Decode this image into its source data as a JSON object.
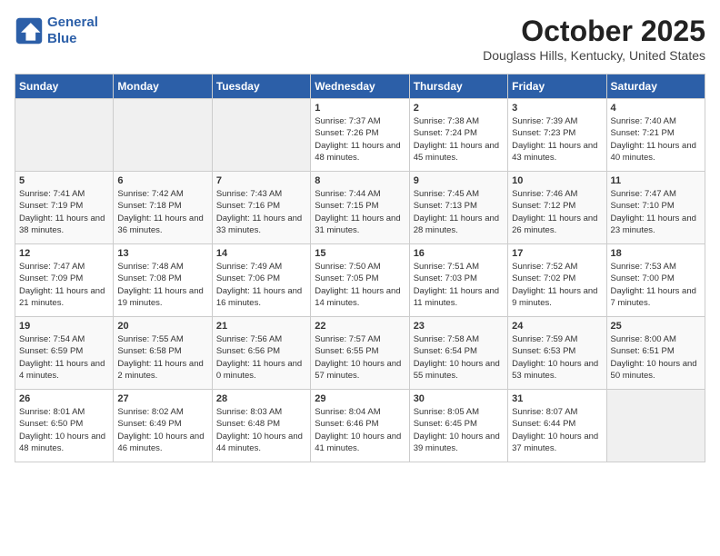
{
  "logo": {
    "line1": "General",
    "line2": "Blue"
  },
  "title": "October 2025",
  "location": "Douglass Hills, Kentucky, United States",
  "days_of_week": [
    "Sunday",
    "Monday",
    "Tuesday",
    "Wednesday",
    "Thursday",
    "Friday",
    "Saturday"
  ],
  "weeks": [
    [
      {
        "day": "",
        "empty": true
      },
      {
        "day": "",
        "empty": true
      },
      {
        "day": "",
        "empty": true
      },
      {
        "day": "1",
        "sunrise": "7:37 AM",
        "sunset": "7:26 PM",
        "daylight": "Daylight: 11 hours and 48 minutes."
      },
      {
        "day": "2",
        "sunrise": "7:38 AM",
        "sunset": "7:24 PM",
        "daylight": "Daylight: 11 hours and 45 minutes."
      },
      {
        "day": "3",
        "sunrise": "7:39 AM",
        "sunset": "7:23 PM",
        "daylight": "Daylight: 11 hours and 43 minutes."
      },
      {
        "day": "4",
        "sunrise": "7:40 AM",
        "sunset": "7:21 PM",
        "daylight": "Daylight: 11 hours and 40 minutes."
      }
    ],
    [
      {
        "day": "5",
        "sunrise": "7:41 AM",
        "sunset": "7:19 PM",
        "daylight": "Daylight: 11 hours and 38 minutes."
      },
      {
        "day": "6",
        "sunrise": "7:42 AM",
        "sunset": "7:18 PM",
        "daylight": "Daylight: 11 hours and 36 minutes."
      },
      {
        "day": "7",
        "sunrise": "7:43 AM",
        "sunset": "7:16 PM",
        "daylight": "Daylight: 11 hours and 33 minutes."
      },
      {
        "day": "8",
        "sunrise": "7:44 AM",
        "sunset": "7:15 PM",
        "daylight": "Daylight: 11 hours and 31 minutes."
      },
      {
        "day": "9",
        "sunrise": "7:45 AM",
        "sunset": "7:13 PM",
        "daylight": "Daylight: 11 hours and 28 minutes."
      },
      {
        "day": "10",
        "sunrise": "7:46 AM",
        "sunset": "7:12 PM",
        "daylight": "Daylight: 11 hours and 26 minutes."
      },
      {
        "day": "11",
        "sunrise": "7:47 AM",
        "sunset": "7:10 PM",
        "daylight": "Daylight: 11 hours and 23 minutes."
      }
    ],
    [
      {
        "day": "12",
        "sunrise": "7:47 AM",
        "sunset": "7:09 PM",
        "daylight": "Daylight: 11 hours and 21 minutes."
      },
      {
        "day": "13",
        "sunrise": "7:48 AM",
        "sunset": "7:08 PM",
        "daylight": "Daylight: 11 hours and 19 minutes."
      },
      {
        "day": "14",
        "sunrise": "7:49 AM",
        "sunset": "7:06 PM",
        "daylight": "Daylight: 11 hours and 16 minutes."
      },
      {
        "day": "15",
        "sunrise": "7:50 AM",
        "sunset": "7:05 PM",
        "daylight": "Daylight: 11 hours and 14 minutes."
      },
      {
        "day": "16",
        "sunrise": "7:51 AM",
        "sunset": "7:03 PM",
        "daylight": "Daylight: 11 hours and 11 minutes."
      },
      {
        "day": "17",
        "sunrise": "7:52 AM",
        "sunset": "7:02 PM",
        "daylight": "Daylight: 11 hours and 9 minutes."
      },
      {
        "day": "18",
        "sunrise": "7:53 AM",
        "sunset": "7:00 PM",
        "daylight": "Daylight: 11 hours and 7 minutes."
      }
    ],
    [
      {
        "day": "19",
        "sunrise": "7:54 AM",
        "sunset": "6:59 PM",
        "daylight": "Daylight: 11 hours and 4 minutes."
      },
      {
        "day": "20",
        "sunrise": "7:55 AM",
        "sunset": "6:58 PM",
        "daylight": "Daylight: 11 hours and 2 minutes."
      },
      {
        "day": "21",
        "sunrise": "7:56 AM",
        "sunset": "6:56 PM",
        "daylight": "Daylight: 11 hours and 0 minutes."
      },
      {
        "day": "22",
        "sunrise": "7:57 AM",
        "sunset": "6:55 PM",
        "daylight": "Daylight: 10 hours and 57 minutes."
      },
      {
        "day": "23",
        "sunrise": "7:58 AM",
        "sunset": "6:54 PM",
        "daylight": "Daylight: 10 hours and 55 minutes."
      },
      {
        "day": "24",
        "sunrise": "7:59 AM",
        "sunset": "6:53 PM",
        "daylight": "Daylight: 10 hours and 53 minutes."
      },
      {
        "day": "25",
        "sunrise": "8:00 AM",
        "sunset": "6:51 PM",
        "daylight": "Daylight: 10 hours and 50 minutes."
      }
    ],
    [
      {
        "day": "26",
        "sunrise": "8:01 AM",
        "sunset": "6:50 PM",
        "daylight": "Daylight: 10 hours and 48 minutes."
      },
      {
        "day": "27",
        "sunrise": "8:02 AM",
        "sunset": "6:49 PM",
        "daylight": "Daylight: 10 hours and 46 minutes."
      },
      {
        "day": "28",
        "sunrise": "8:03 AM",
        "sunset": "6:48 PM",
        "daylight": "Daylight: 10 hours and 44 minutes."
      },
      {
        "day": "29",
        "sunrise": "8:04 AM",
        "sunset": "6:46 PM",
        "daylight": "Daylight: 10 hours and 41 minutes."
      },
      {
        "day": "30",
        "sunrise": "8:05 AM",
        "sunset": "6:45 PM",
        "daylight": "Daylight: 10 hours and 39 minutes."
      },
      {
        "day": "31",
        "sunrise": "8:07 AM",
        "sunset": "6:44 PM",
        "daylight": "Daylight: 10 hours and 37 minutes."
      },
      {
        "day": "",
        "empty": true
      }
    ]
  ]
}
